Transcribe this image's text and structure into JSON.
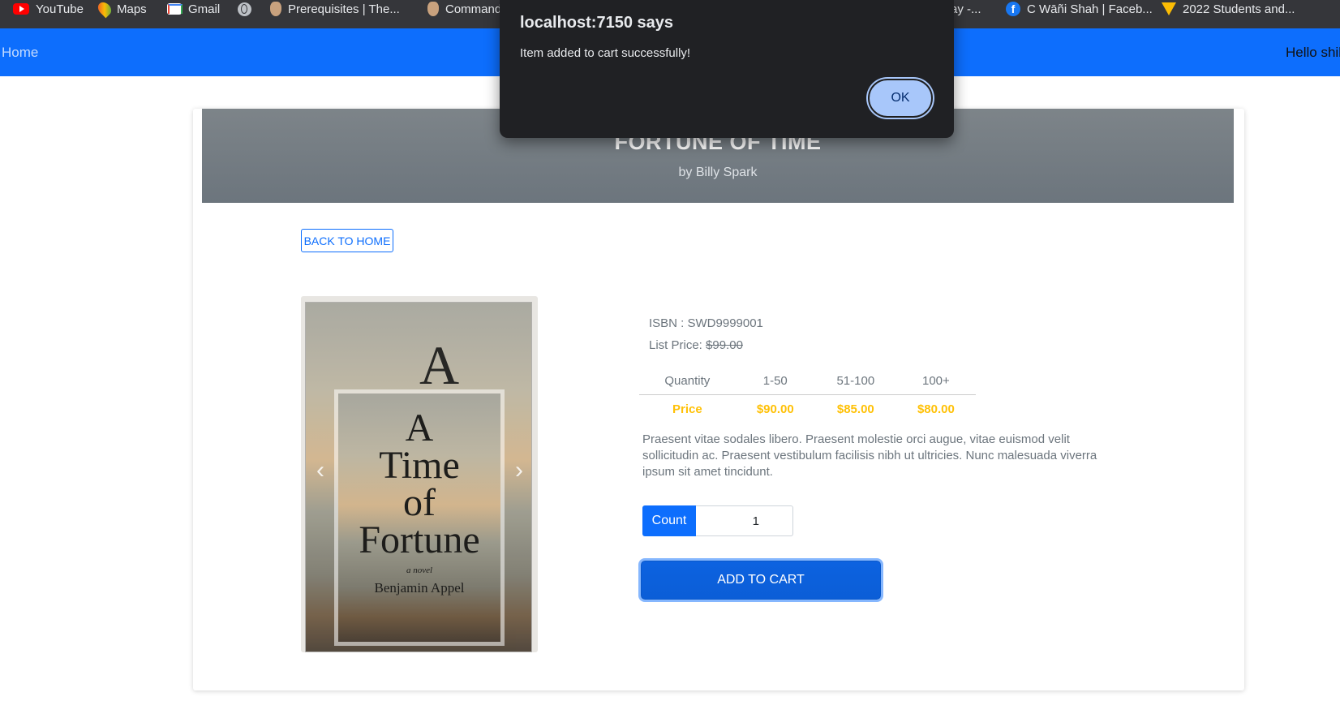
{
  "bookmarks": [
    {
      "icon": "youtube-icon",
      "label": "YouTube"
    },
    {
      "icon": "maps-icon",
      "label": "Maps"
    },
    {
      "icon": "gmail-icon",
      "label": "Gmail"
    },
    {
      "icon": "globe-icon",
      "label": ""
    },
    {
      "icon": "deer-icon",
      "label": "Prerequisites | The..."
    },
    {
      "icon": "deer-icon",
      "label": "Command"
    },
    {
      "icon": "",
      "label": "ay -..."
    },
    {
      "icon": "facebook-icon",
      "label": "C Wāñi Shah | Faceb..."
    },
    {
      "icon": "rainbow-icon",
      "label": "2022 Students and..."
    }
  ],
  "navbar": {
    "home_label": "Home",
    "greeting": "Hello shib"
  },
  "product": {
    "title": "Fortune of Time",
    "author": "by Billy Spark",
    "back_label": "Back to Home",
    "isbn_label": "ISBN : SWD9999001",
    "list_price_label": "List Price:",
    "list_price": "$99.00",
    "cover": {
      "line1": "A",
      "line2": "Time",
      "line3": "of",
      "line4": "Fortune",
      "subtitle": "a novel",
      "author": "Benjamin Appel"
    },
    "price_table": {
      "headers": [
        "Quantity",
        "1-50",
        "51-100",
        "100+"
      ],
      "prices": [
        "Price",
        "$90.00",
        "$85.00",
        "$80.00"
      ]
    },
    "description": "Praesent vitae sodales libero. Praesent molestie orci augue, vitae euismod velit sollicitudin ac. Praesent vestibulum facilisis nibh ut ultricies. Nunc malesuada viverra ipsum sit amet tincidunt.",
    "count_label": "Count",
    "count_value": "1",
    "add_to_cart_label": "Add to Cart",
    "carousel_prev": "‹",
    "carousel_next": "›"
  },
  "alert": {
    "title": "localhost:7150 says",
    "message": "Item added to cart successfully!",
    "ok_label": "OK"
  },
  "colors": {
    "primary": "#0d6efd",
    "header_gray": "#6c757d",
    "price_yellow": "#ffc107",
    "dialog_bg": "#202124",
    "ok_button": "#a8c7fa"
  }
}
